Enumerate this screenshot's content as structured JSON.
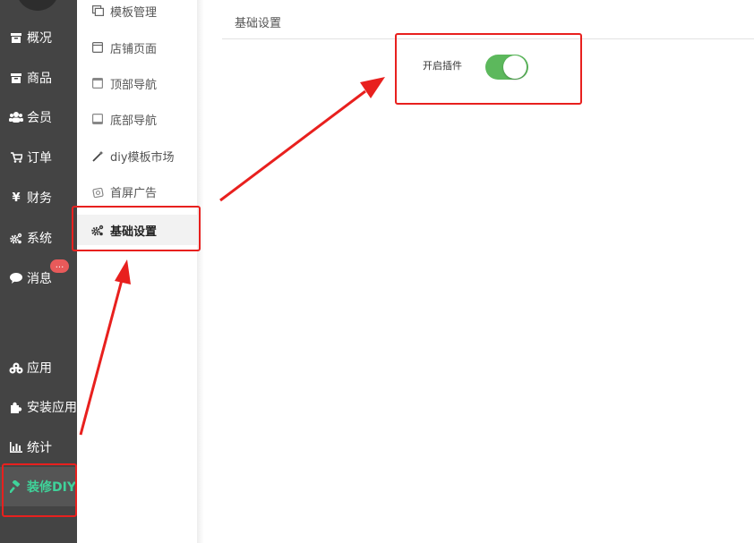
{
  "left_nav": {
    "items": [
      {
        "label": "概况",
        "icon": "box-icon"
      },
      {
        "label": "商品",
        "icon": "box-icon"
      },
      {
        "label": "会员",
        "icon": "users-icon"
      },
      {
        "label": "订单",
        "icon": "cart-icon"
      },
      {
        "label": "财务",
        "icon": "yen-icon"
      },
      {
        "label": "系统",
        "icon": "gears-icon"
      },
      {
        "label": "消息",
        "icon": "chat-icon"
      },
      {
        "label": "应用",
        "icon": "cubes-icon"
      },
      {
        "label": "安装应用",
        "icon": "puzzle-icon"
      },
      {
        "label": "统计",
        "icon": "bar-chart-icon"
      },
      {
        "label": "装修DIY",
        "icon": "hammer-icon"
      }
    ],
    "message_badge": "...",
    "active": "装修DIY",
    "active_color": "#3fd39a"
  },
  "submenu": {
    "items": [
      {
        "label": "模板管理",
        "icon": "templates-icon"
      },
      {
        "label": "店铺页面",
        "icon": "window-icon"
      },
      {
        "label": "顶部导航",
        "icon": "top-nav-icon"
      },
      {
        "label": "底部导航",
        "icon": "bottom-nav-icon"
      },
      {
        "label": "diy模板市场",
        "icon": "magic-wand-icon"
      },
      {
        "label": "首屏广告",
        "icon": "ad-icon"
      },
      {
        "label": "基础设置",
        "icon": "gears-icon"
      }
    ],
    "active": "基础设置"
  },
  "main": {
    "title": "基础设置",
    "setting_label": "开启插件",
    "plugin_enabled": true,
    "toggle_color": "#5cb85c"
  },
  "annotation_color": "#e8201e"
}
